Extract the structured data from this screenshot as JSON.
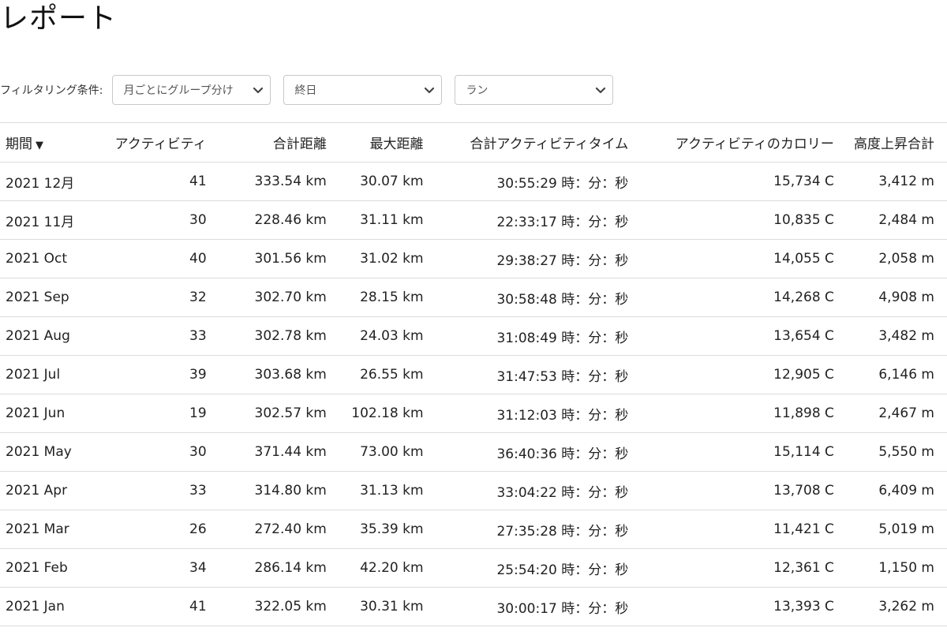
{
  "page": {
    "title": "レポート"
  },
  "filters": {
    "label": "フィルタリング条件:",
    "group_by": "月ごとにグループ分け",
    "range": "終日",
    "activity_type": "ラン"
  },
  "table": {
    "headers": {
      "period": "期間",
      "sort_indicator": "▼",
      "activities": "アクティビティ",
      "total_distance": "合計距離",
      "max_distance": "最大距離",
      "total_time": "合計アクティビティタイム",
      "calories": "アクティビティのカロリー",
      "elevation": "高度上昇合計"
    },
    "rows": [
      {
        "period": "2021 12月",
        "activities": "41",
        "total_distance": "333.54 km",
        "max_distance": "30.07 km",
        "total_time": "30:55:29 時：分：秒",
        "calories": "15,734 C",
        "elevation": "3,412 m"
      },
      {
        "period": "2021 11月",
        "activities": "30",
        "total_distance": "228.46 km",
        "max_distance": "31.11 km",
        "total_time": "22:33:17 時：分：秒",
        "calories": "10,835 C",
        "elevation": "2,484 m"
      },
      {
        "period": "2021 Oct",
        "activities": "40",
        "total_distance": "301.56 km",
        "max_distance": "31.02 km",
        "total_time": "29:38:27 時：分：秒",
        "calories": "14,055 C",
        "elevation": "2,058 m"
      },
      {
        "period": "2021 Sep",
        "activities": "32",
        "total_distance": "302.70 km",
        "max_distance": "28.15 km",
        "total_time": "30:58:48 時：分：秒",
        "calories": "14,268 C",
        "elevation": "4,908 m"
      },
      {
        "period": "2021 Aug",
        "activities": "33",
        "total_distance": "302.78 km",
        "max_distance": "24.03 km",
        "total_time": "31:08:49 時：分：秒",
        "calories": "13,654 C",
        "elevation": "3,482 m"
      },
      {
        "period": "2021 Jul",
        "activities": "39",
        "total_distance": "303.68 km",
        "max_distance": "26.55 km",
        "total_time": "31:47:53 時：分：秒",
        "calories": "12,905 C",
        "elevation": "6,146 m"
      },
      {
        "period": "2021 Jun",
        "activities": "19",
        "total_distance": "302.57 km",
        "max_distance": "102.18 km",
        "total_time": "31:12:03 時：分：秒",
        "calories": "11,898 C",
        "elevation": "2,467 m"
      },
      {
        "period": "2021 May",
        "activities": "30",
        "total_distance": "371.44 km",
        "max_distance": "73.00 km",
        "total_time": "36:40:36 時：分：秒",
        "calories": "15,114 C",
        "elevation": "5,550 m"
      },
      {
        "period": "2021 Apr",
        "activities": "33",
        "total_distance": "314.80 km",
        "max_distance": "31.13 km",
        "total_time": "33:04:22 時：分：秒",
        "calories": "13,708 C",
        "elevation": "6,409 m"
      },
      {
        "period": "2021 Mar",
        "activities": "26",
        "total_distance": "272.40 km",
        "max_distance": "35.39 km",
        "total_time": "27:35:28 時：分：秒",
        "calories": "11,421 C",
        "elevation": "5,019 m"
      },
      {
        "period": "2021 Feb",
        "activities": "34",
        "total_distance": "286.14 km",
        "max_distance": "42.20 km",
        "total_time": "25:54:20 時：分：秒",
        "calories": "12,361 C",
        "elevation": "1,150 m"
      },
      {
        "period": "2021 Jan",
        "activities": "41",
        "total_distance": "322.05 km",
        "max_distance": "30.31 km",
        "total_time": "30:00:17 時：分：秒",
        "calories": "13,393 C",
        "elevation": "3,262 m"
      }
    ]
  },
  "icons": {
    "select_arrow": "chevron-down-icon"
  },
  "colors": {
    "text": "#222222",
    "border": "#dcdcdc",
    "select_border": "#c9c9c9"
  }
}
